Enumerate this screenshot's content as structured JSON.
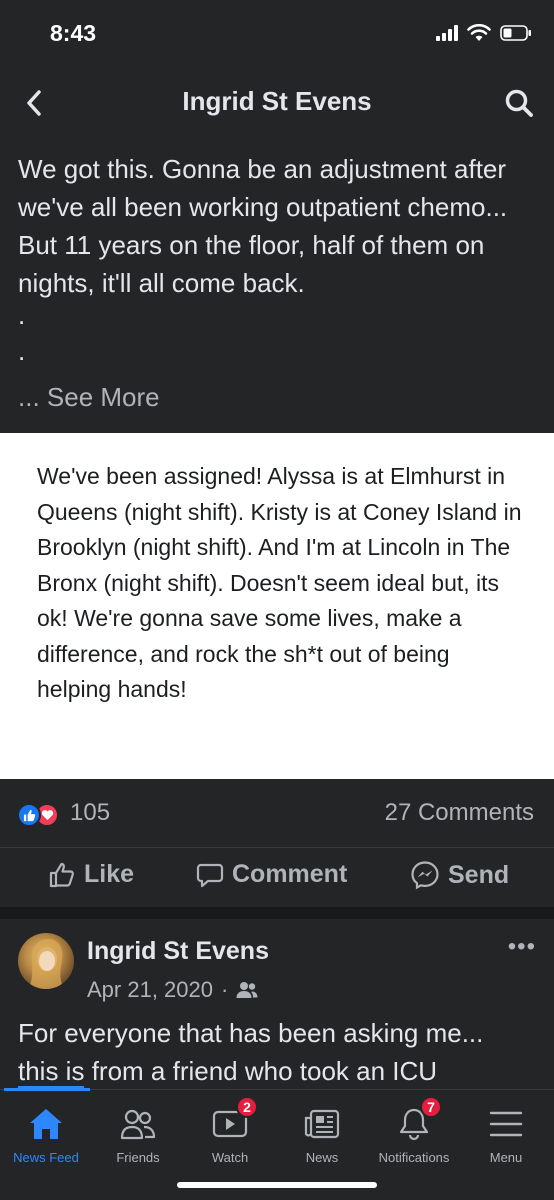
{
  "status_bar": {
    "time": "8:43"
  },
  "header": {
    "title": "Ingrid St Evens"
  },
  "post": {
    "text": "We got this. Gonna be an adjustment after we've all been working outpatient chemo... But 11 years on the floor, half of them on nights, it'll all come back.",
    "dot1": ".",
    "dot2": ".",
    "see_more": "... See More",
    "shared_text": "We've been assigned! Alyssa is at Elmhurst in Queens (night shift). Kristy is at Coney Island in Brooklyn (night shift). And I'm at Lincoln in The Bronx (night shift). Doesn't seem ideal but, its ok! We're gonna save some lives, make a difference, and rock the sh*t out of being helping hands!",
    "reaction_count": "105",
    "comments_count": "27 Comments",
    "actions": {
      "like": "Like",
      "comment": "Comment",
      "send": "Send"
    }
  },
  "next_post": {
    "author": "Ingrid St Evens",
    "date": "Apr 21, 2020",
    "meta_separator": "·",
    "more": "•••",
    "text_line1": "For everyone that has been asking me...",
    "text_link": "this is",
    "text_rest": " from a friend who took an ICU"
  },
  "tabbar": {
    "tabs": [
      {
        "label": "News Feed",
        "icon": "home-icon"
      },
      {
        "label": "Friends",
        "icon": "friends-icon"
      },
      {
        "label": "Watch",
        "icon": "watch-icon",
        "badge": "2"
      },
      {
        "label": "News",
        "icon": "news-icon"
      },
      {
        "label": "Notifications",
        "icon": "bell-icon",
        "badge": "7"
      },
      {
        "label": "Menu",
        "icon": "menu-icon"
      }
    ]
  },
  "colors": {
    "accent": "#2d88ff",
    "badge": "#e41e3f",
    "like": "#1877f2",
    "love": "#f33e58"
  }
}
